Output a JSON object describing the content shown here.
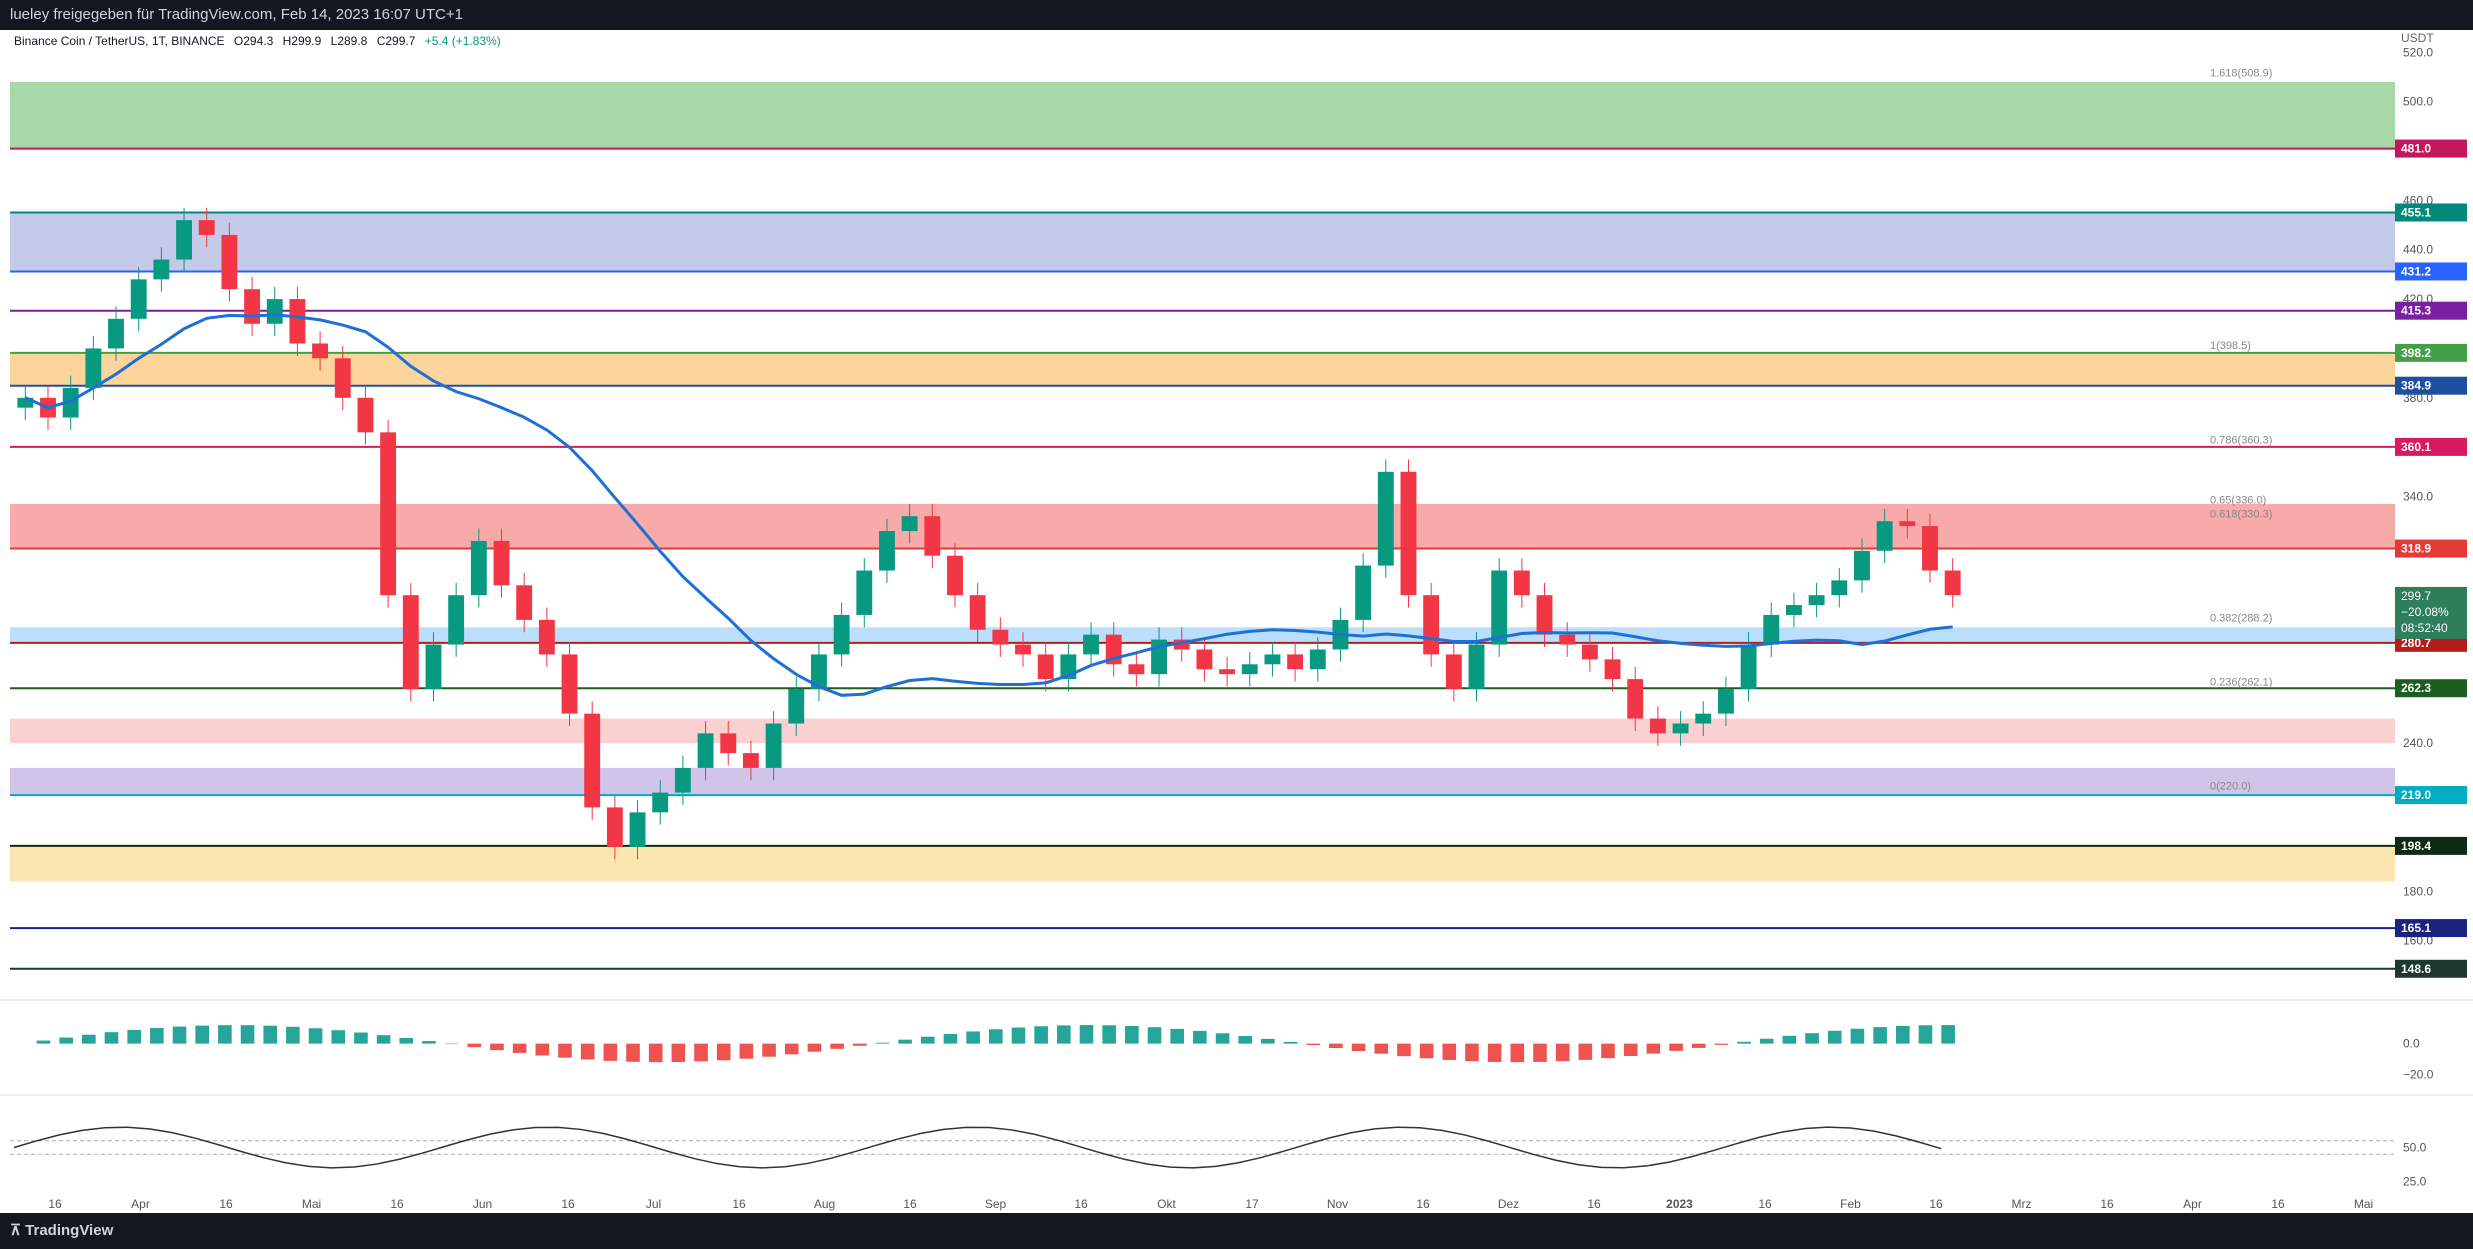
{
  "header": {
    "title": "lueley freigegeben für TradingView.com, Feb 14, 2023 16:07 UTC+1"
  },
  "legend": {
    "symbol": "Binance Coin / TetherUS, 1T, BINANCE",
    "open": "O294.3",
    "high": "H299.9",
    "low": "L289.8",
    "close": "C299.7",
    "change": "+5.4 (+1.83%)"
  },
  "footer": {
    "brand": "TradingView"
  },
  "colors": {
    "up": "#089981",
    "down": "#f23645",
    "ma": "#1e6fd6",
    "green_zone": "#a8d8a8",
    "blue_zone": "#c5cae9",
    "orange_zone": "#fdd49a",
    "red_zone": "#f8a9a9",
    "light_red_zone": "#fbd0d0",
    "purple_zone": "#d1c4e9",
    "yellow_zone": "#fbe6b0",
    "lightblue_zone": "#bbdefb"
  },
  "chart_data": {
    "type": "candlestick",
    "currency": "USDT",
    "ylim": [
      140,
      525
    ],
    "y_ticks": [
      520,
      500,
      460,
      440,
      420,
      380,
      340,
      240,
      180,
      160
    ],
    "x_ticks": [
      "16",
      "Apr",
      "16",
      "Mai",
      "16",
      "Jun",
      "16",
      "Jul",
      "16",
      "Aug",
      "16",
      "Sep",
      "16",
      "Okt",
      "17",
      "Nov",
      "16",
      "Dez",
      "16",
      "2023",
      "16",
      "Feb",
      "16",
      "Mrz",
      "16",
      "Apr",
      "16",
      "Mai"
    ],
    "levels": [
      {
        "value": 481.0,
        "label": "481.0",
        "color": "#c2185b"
      },
      {
        "value": 455.1,
        "label": "455.1",
        "color": "#00897b"
      },
      {
        "value": 431.2,
        "label": "431.2",
        "color": "#2962ff"
      },
      {
        "value": 415.3,
        "label": "415.3",
        "color": "#7b1fa2"
      },
      {
        "value": 398.2,
        "label": "398.2",
        "color": "#43a047"
      },
      {
        "value": 384.9,
        "label": "384.9",
        "color": "#1e4fa1"
      },
      {
        "value": 360.1,
        "label": "360.1",
        "color": "#d81b60"
      },
      {
        "value": 318.9,
        "label": "318.9",
        "color": "#e53935"
      },
      {
        "value": 280.7,
        "label": "280.7",
        "color": "#b71c1c"
      },
      {
        "value": 262.3,
        "label": "262.3",
        "color": "#1b5e20"
      },
      {
        "value": 219.0,
        "label": "219.0",
        "color": "#00acc1"
      },
      {
        "value": 198.4,
        "label": "198.4",
        "color": "#0d2b12"
      },
      {
        "value": 165.1,
        "label": "165.1",
        "color": "#1a237e"
      },
      {
        "value": 148.6,
        "label": "148.6",
        "color": "#1b3a2b"
      }
    ],
    "current": {
      "value": 299.7,
      "label": "299.7",
      "change": "−20.08%",
      "timer": "08:52:40"
    },
    "fib": [
      {
        "value": 508.9,
        "label": "1.618(508.9)"
      },
      {
        "value": 398.5,
        "label": "1(398.5)"
      },
      {
        "value": 360.3,
        "label": "0.786(360.3)"
      },
      {
        "value": 336.0,
        "label": "0.65(336.0)"
      },
      {
        "value": 330.3,
        "label": "0.618(330.3)"
      },
      {
        "value": 288.2,
        "label": "0.382(288.2)"
      },
      {
        "value": 262.1,
        "label": "0.236(262.1)"
      },
      {
        "value": 220.0,
        "label": "0(220.0)"
      }
    ],
    "zones": [
      {
        "from": 481,
        "to": 508,
        "color": "green_zone"
      },
      {
        "from": 431.2,
        "to": 455.1,
        "color": "blue_zone"
      },
      {
        "from": 384.9,
        "to": 398.2,
        "color": "orange_zone"
      },
      {
        "from": 318.9,
        "to": 337,
        "color": "red_zone"
      },
      {
        "from": 280.7,
        "to": 287,
        "color": "lightblue_zone"
      },
      {
        "from": 240,
        "to": 250,
        "color": "light_red_zone"
      },
      {
        "from": 219,
        "to": 230,
        "color": "purple_zone"
      },
      {
        "from": 184,
        "to": 198.4,
        "color": "yellow_zone"
      }
    ],
    "closes": [
      380,
      372,
      384,
      400,
      412,
      428,
      436,
      452,
      446,
      424,
      410,
      420,
      402,
      396,
      380,
      366,
      300,
      262,
      280,
      300,
      322,
      304,
      290,
      276,
      252,
      214,
      198,
      212,
      220,
      230,
      244,
      236,
      230,
      248,
      262,
      276,
      292,
      310,
      326,
      332,
      316,
      300,
      286,
      280,
      276,
      266,
      276,
      284,
      272,
      268,
      282,
      278,
      270,
      268,
      272,
      276,
      270,
      278,
      290,
      312,
      350,
      300,
      276,
      262,
      280,
      310,
      300,
      284,
      280,
      274,
      266,
      250,
      244,
      248,
      252,
      262,
      280,
      292,
      296,
      300,
      306,
      318,
      330,
      328,
      310,
      300
    ],
    "macd": {
      "ylim": [
        -30,
        25
      ],
      "ticks": [
        "0.0",
        "−20.0"
      ]
    },
    "rsi": {
      "ylim": [
        15,
        85
      ],
      "ticks": [
        "50.0",
        "25.0"
      ]
    }
  }
}
